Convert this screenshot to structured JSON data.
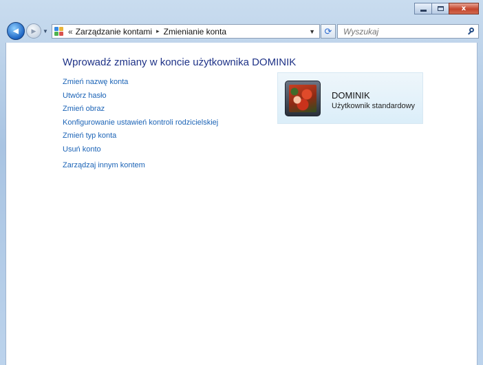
{
  "window": {
    "caption_buttons": {
      "minimize": "minimize-icon",
      "maximize": "maximize-icon",
      "close": "x"
    }
  },
  "nav": {
    "back_glyph": "◀",
    "forward_glyph": "▶",
    "history_dropdown": "▼",
    "breadcrumb_prefix": "«",
    "breadcrumb": [
      "Zarządzanie kontami",
      "Zmienianie konta"
    ],
    "breadcrumb_separator": "▸",
    "address_dropdown": "▼",
    "refresh_glyph": "⟳"
  },
  "search": {
    "placeholder": "Wyszukaj"
  },
  "page": {
    "title": "Wprowadź zmiany w koncie użytkownika DOMINIK",
    "links": [
      "Zmień nazwę konta",
      "Utwórz hasło",
      "Zmień obraz",
      "Konfigurowanie ustawień kontroli rodzicielskiej",
      "Zmień typ konta",
      "Usuń konto"
    ],
    "manage_other": "Zarządzaj innym kontem"
  },
  "account": {
    "name": "DOMINIK",
    "type": "Użytkownik standardowy"
  },
  "colors": {
    "heading": "#1e3287",
    "link": "#1b63b6",
    "frame": "#b9d1ea"
  }
}
